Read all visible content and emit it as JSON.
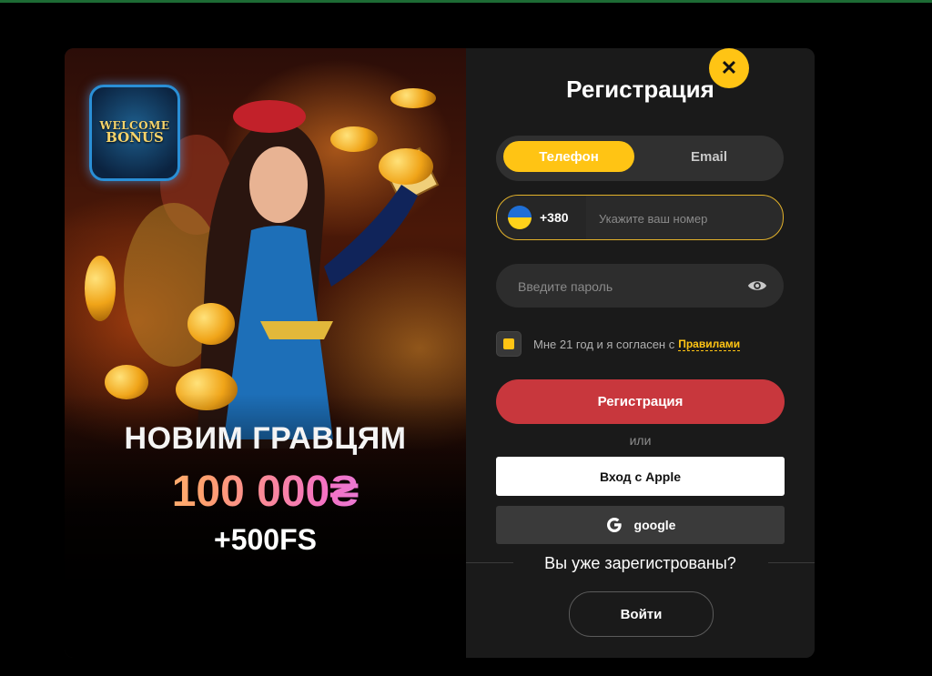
{
  "promo": {
    "badge_line1": "WELCOME",
    "badge_line2": "BONUS",
    "headline": "НОВИМ ГРАВЦЯМ",
    "amount": "100 000₴",
    "spins": "+500FS"
  },
  "form": {
    "title": "Регистрация",
    "tabs": [
      {
        "label": "Телефон",
        "active": true
      },
      {
        "label": "Email",
        "active": false
      }
    ],
    "phone": {
      "country_code": "+380",
      "placeholder": "Укажите ваш номер",
      "value": ""
    },
    "password": {
      "placeholder": "Введите пароль",
      "value": ""
    },
    "agreement": {
      "text": "Мне 21 год и я согласен с",
      "link": "Правилами",
      "checked": true
    },
    "register_button": "Регистрация",
    "or_text": "или",
    "apple_button": "Вход с Apple",
    "google_button": "google",
    "already_registered": "Вы уже зарегистрованы?",
    "login_button": "Войти"
  },
  "colors": {
    "accent": "#ffc414",
    "register": "#c8373d",
    "panel": "#1a1a1a"
  },
  "icons": {
    "close": "close-icon",
    "eye": "eye-icon",
    "google": "google-g-icon",
    "flag": "ukraine-flag-icon"
  }
}
